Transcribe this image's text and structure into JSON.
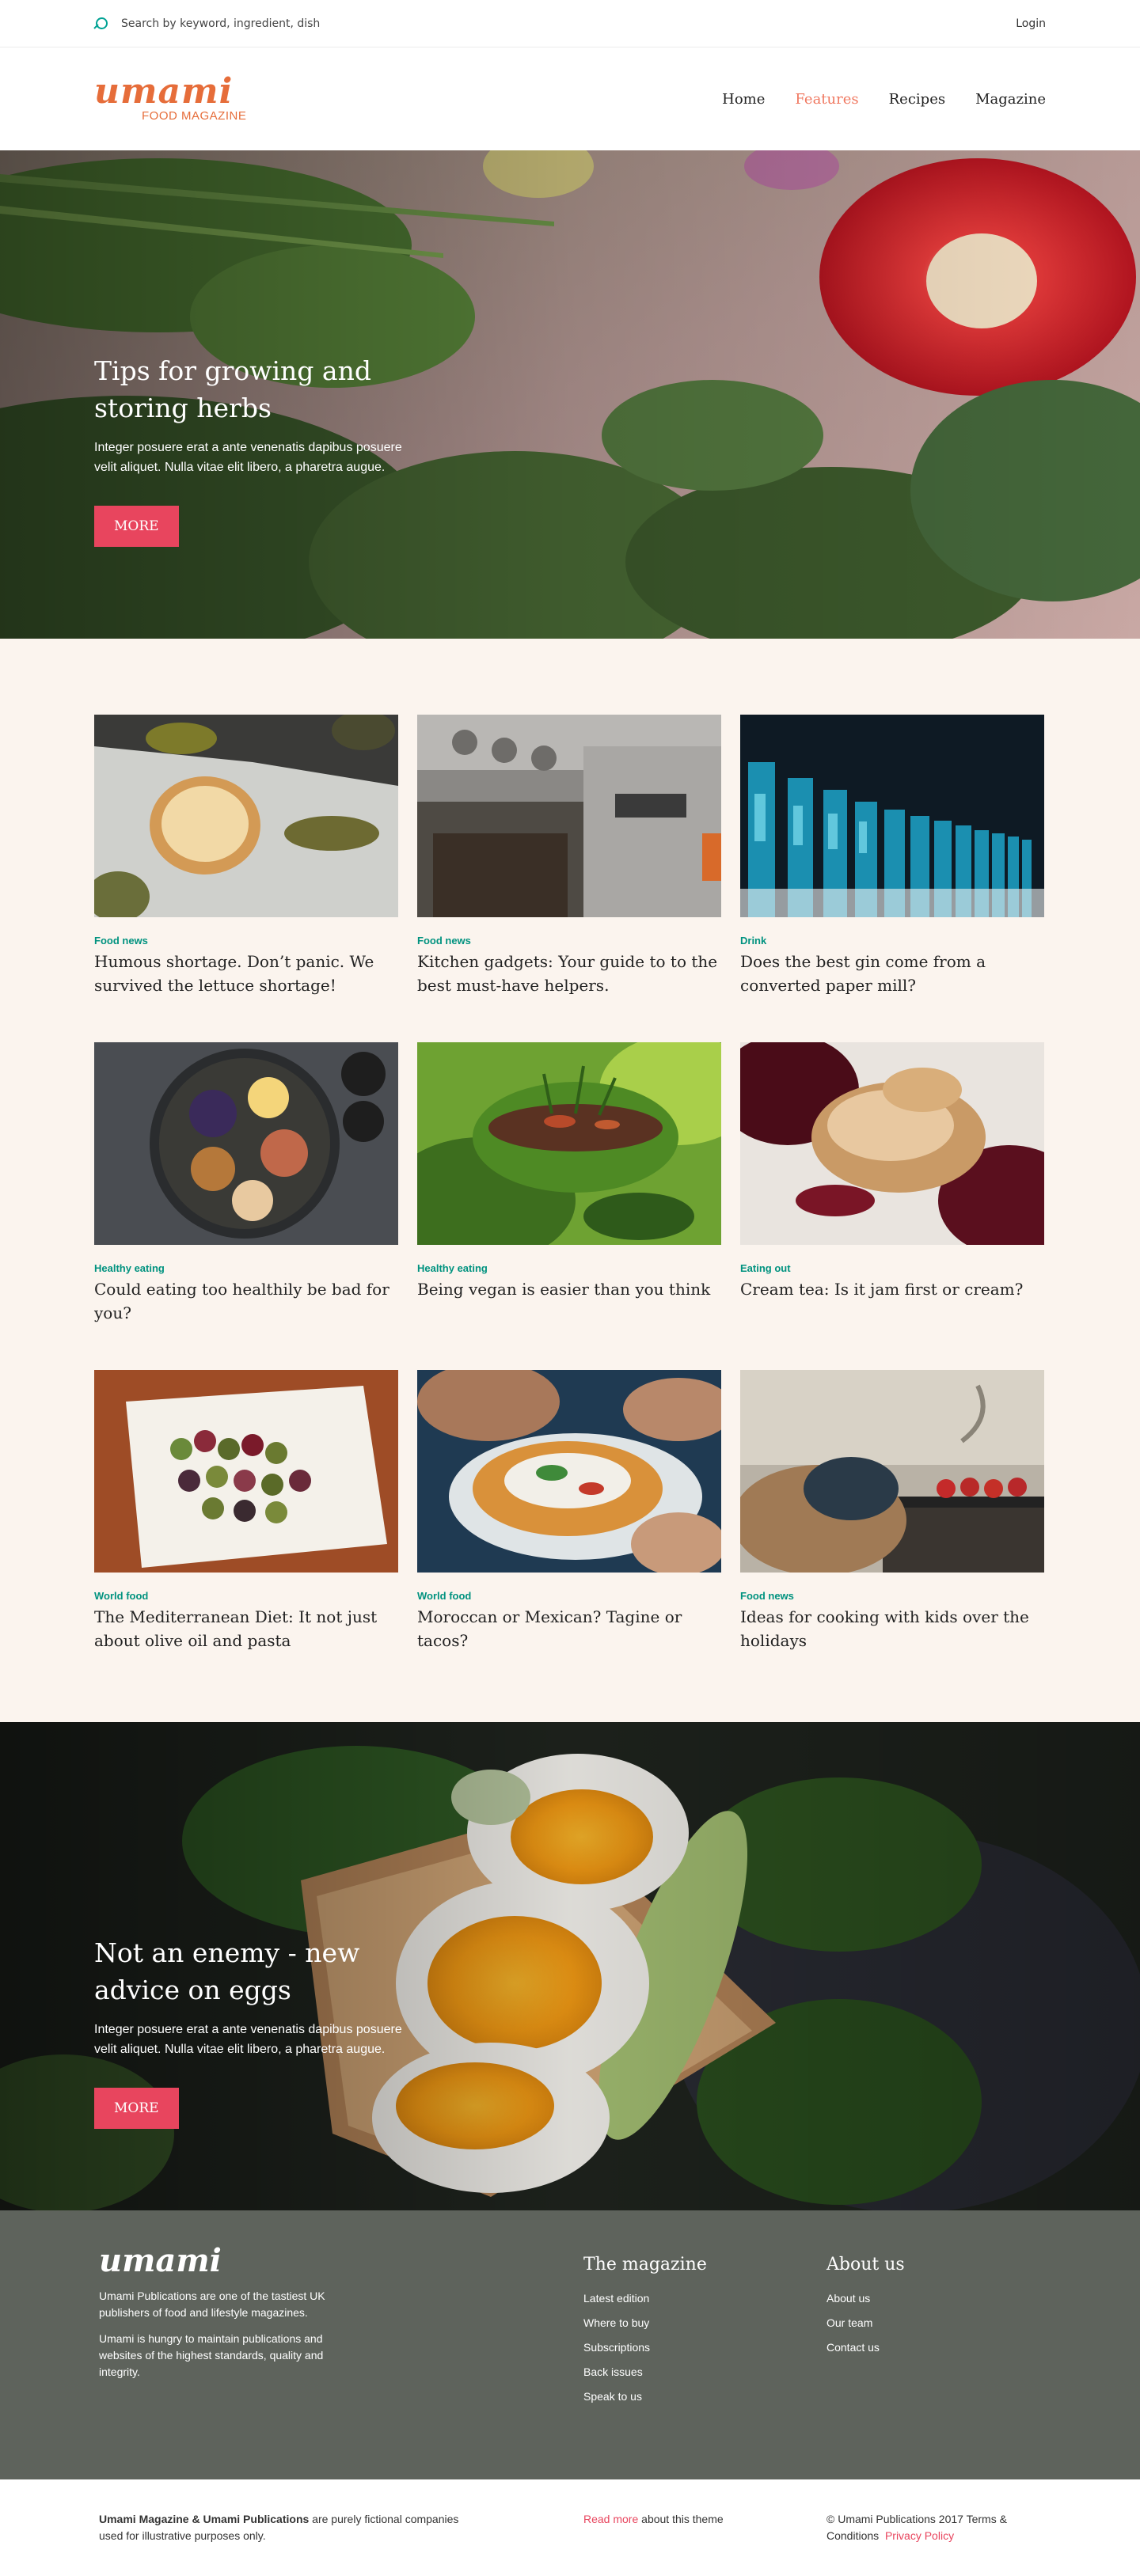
{
  "topbar": {
    "search_placeholder": "Search by keyword, ingredient, dish",
    "login_label": "Login"
  },
  "header": {
    "logo_text": "umami",
    "logo_subtitle": "FOOD MAGAZINE",
    "nav": [
      {
        "label": "Home",
        "active": false
      },
      {
        "label": "Features",
        "active": true
      },
      {
        "label": "Recipes",
        "active": false
      },
      {
        "label": "Magazine",
        "active": false
      }
    ]
  },
  "hero": {
    "title": "Tips for growing and storing herbs",
    "description": "Integer posuere erat a ante venenatis dapibus posuere velit aliquet. Nulla vitae elit libero, a pharetra augue.",
    "button_label": "MORE"
  },
  "cards": [
    {
      "category": "Food news",
      "title": "Humous shortage. Don’t panic. We survived the lettuce shortage!",
      "image": "hummus-bowl"
    },
    {
      "category": "Food news",
      "title": "Kitchen gadgets: Your guide to to the best must-have helpers.",
      "image": "oven"
    },
    {
      "category": "Drink",
      "title": "Does the best gin come from a converted paper mill?",
      "image": "gin-bottles"
    },
    {
      "category": "Healthy eating",
      "title": "Could eating too healthily be bad for you?",
      "image": "food-platter"
    },
    {
      "category": "Healthy eating",
      "title": "Being vegan is easier than you think",
      "image": "salad-bowl"
    },
    {
      "category": "Eating out",
      "title": "Cream tea: Is it jam first or cream?",
      "image": "cream-dessert"
    },
    {
      "category": "World food",
      "title": "The Mediterranean Diet: It not just about olive oil and pasta",
      "image": "olives"
    },
    {
      "category": "World food",
      "title": "Moroccan or Mexican? Tagine or tacos?",
      "image": "nachos"
    },
    {
      "category": "Food news",
      "title": "Ideas for cooking with kids over the holidays",
      "image": "kids-kitchen"
    }
  ],
  "hero2": {
    "title": "Not an enemy - new advice on eggs",
    "description": "Integer posuere erat a ante venenatis dapibus posuere velit aliquet. Nulla vitae elit libero, a pharetra augue.",
    "button_label": "MORE"
  },
  "footer": {
    "logo_text": "umami",
    "para1": "Umami Publications are one of the tastiest UK publishers of food and lifestyle magazines.",
    "para2": "Umami is hungry to maintain publications and websites of the highest standards, quality and integrity.",
    "magazine": {
      "heading": "The magazine",
      "links": [
        "Latest edition",
        "Where to buy",
        "Subscriptions",
        "Back issues",
        "Speak to us"
      ]
    },
    "about": {
      "heading": "About us",
      "links": [
        "About us",
        "Our team",
        "Contact us"
      ]
    }
  },
  "bottombar": {
    "bold_text": "Umami Magazine & Umami Publications",
    "rest_text": " are purely fictional companies used for illustrative purposes only.",
    "read_more": "Read more",
    "about_theme": " about this theme",
    "copyright": "© Umami Publications 2017 Terms & Conditions",
    "privacy": "Privacy Policy"
  },
  "colors": {
    "accent": "#e66d3a",
    "button": "#e8455e",
    "category": "#00927f",
    "footer_bg": "#5e635c",
    "section_bg": "#fbf4ee"
  }
}
